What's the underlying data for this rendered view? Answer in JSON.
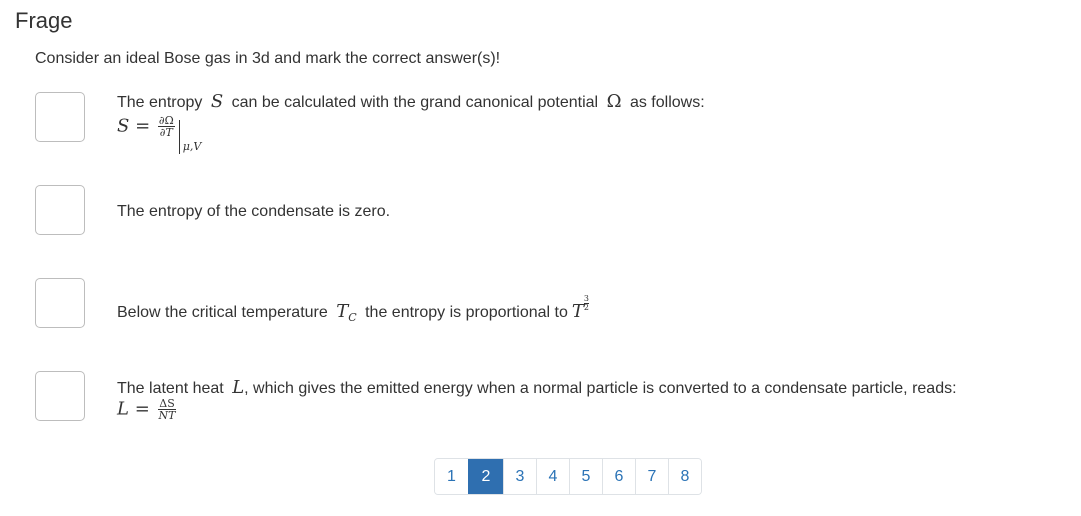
{
  "header": {
    "title": "Frage"
  },
  "question": {
    "prompt": "Consider an ideal Bose gas in 3d and mark the correct answer(s)!"
  },
  "options": [
    {
      "text_before": "The entropy",
      "symbol_1": "S",
      "text_middle": "can be calculated with the grand canonical potential",
      "symbol_2": "Ω",
      "text_after": "as follows:",
      "formula": {
        "lhs": "S",
        "eq": "=",
        "num": "∂Ω",
        "den": "∂T",
        "eval_sub": "μ,V"
      },
      "checked": false
    },
    {
      "text": "The entropy of the condensate is zero.",
      "checked": false
    },
    {
      "text_before": "Below the critical temperature",
      "symbol_1": "T",
      "symbol_1_sub": "C",
      "text_middle": "the entropy is proportional to",
      "symbol_2": "T",
      "exp_num": "3",
      "exp_den": "2",
      "checked": false
    },
    {
      "text_before": "The latent heat",
      "symbol_1": "L",
      "text_after": ", which gives the emitted energy when a normal particle is converted to a condensate particle, reads:",
      "formula": {
        "lhs": "L",
        "eq": "=",
        "num": "ΔS",
        "den": "NT"
      },
      "checked": false
    }
  ],
  "pagination": {
    "pages": [
      "1",
      "2",
      "3",
      "4",
      "5",
      "6",
      "7",
      "8"
    ],
    "current": "2"
  },
  "colors": {
    "accent": "#2f6fb0",
    "link": "#2b73b6",
    "text": "#333333",
    "border": "#bdbdbd"
  }
}
